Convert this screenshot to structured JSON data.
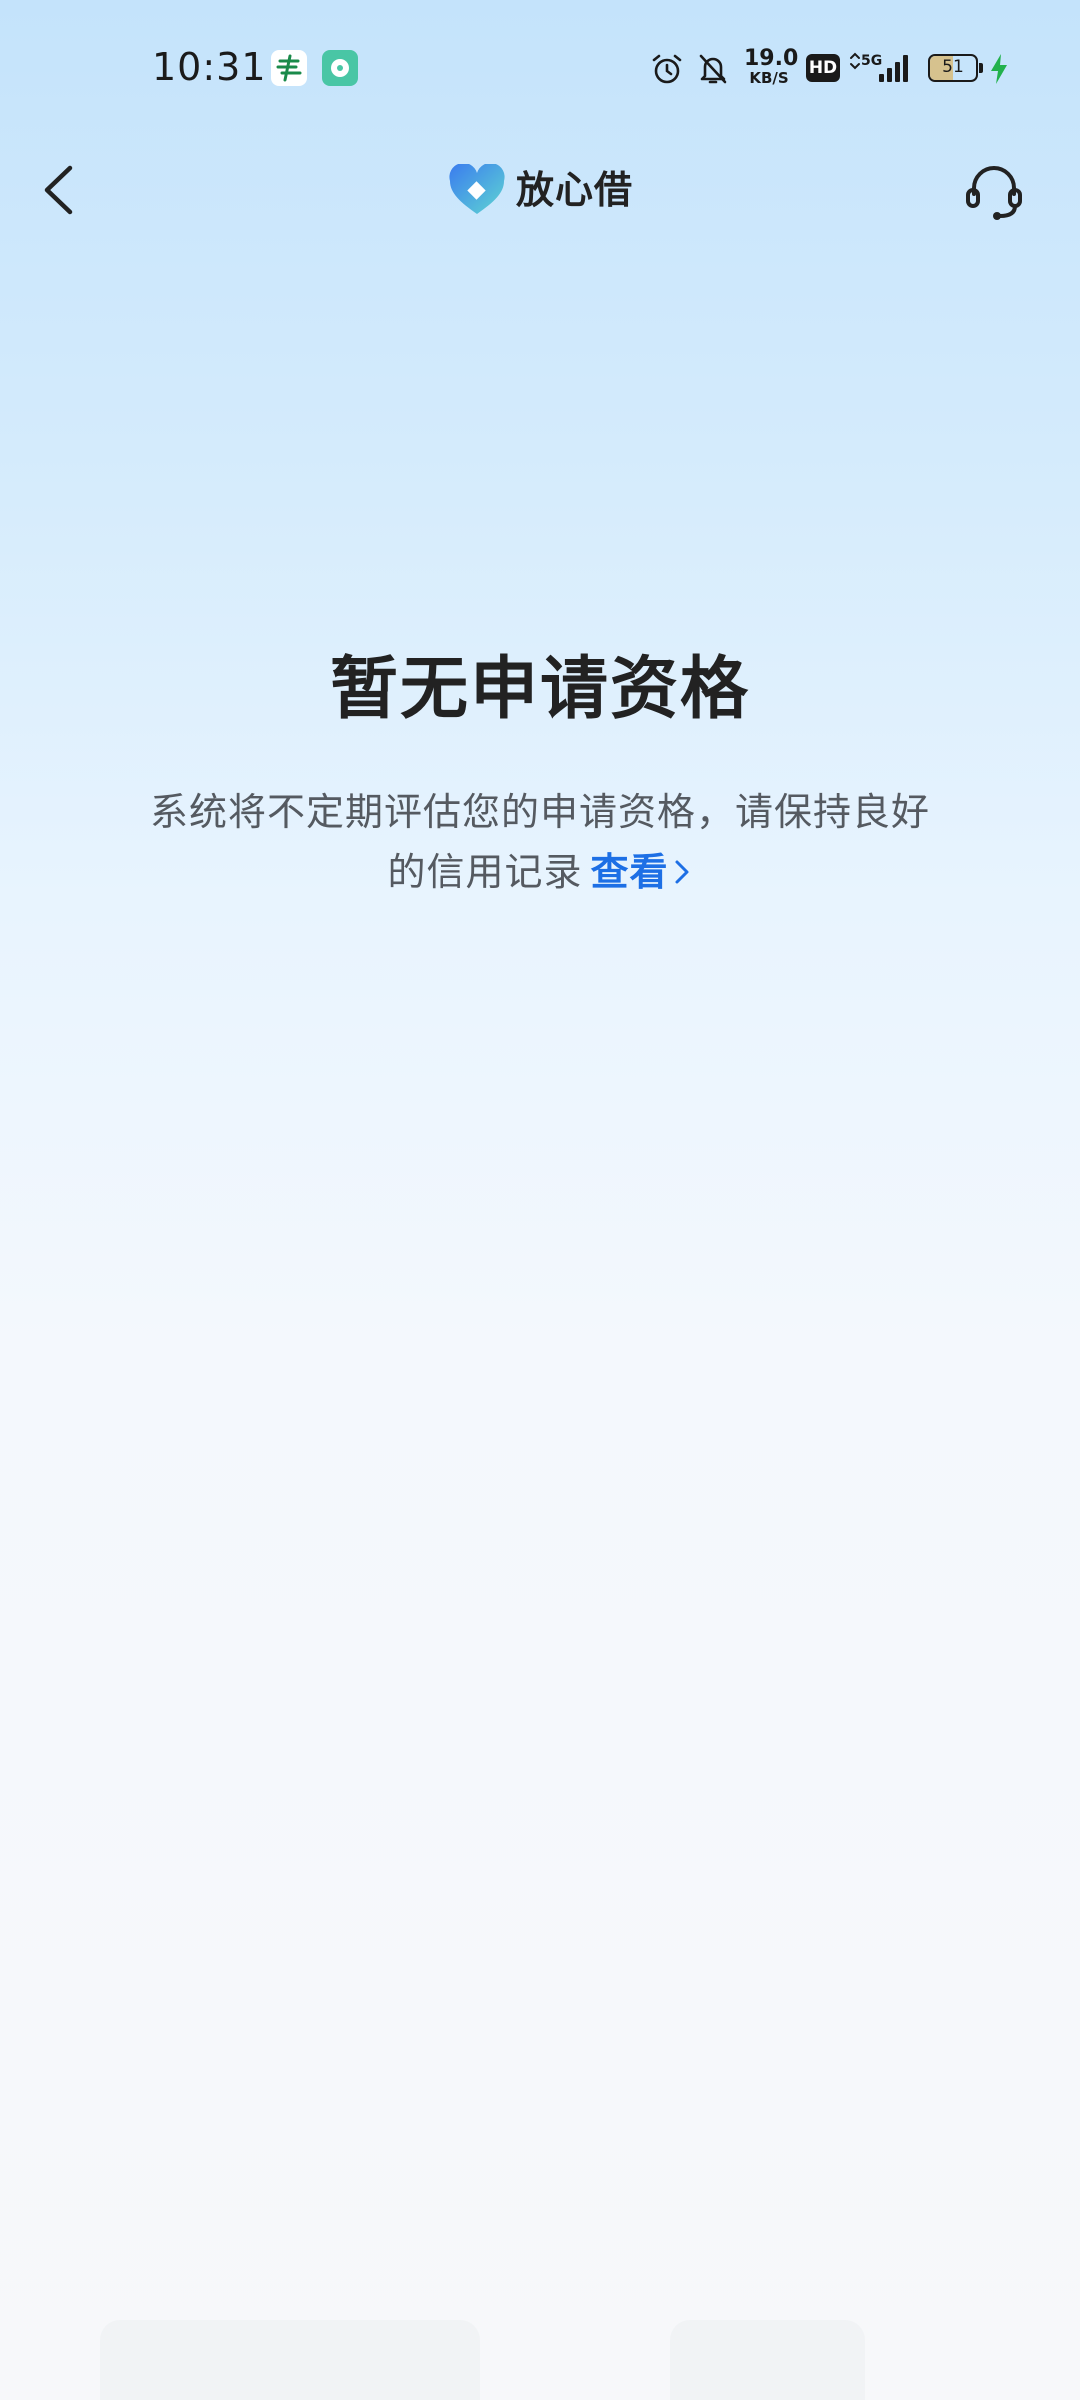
{
  "status_bar": {
    "time": "10:31",
    "app_icons": [
      "post-office-icon",
      "music-app-icon"
    ],
    "icons": [
      "alarm-icon",
      "bell-muted-icon",
      "hd-icon",
      "signal-5g-icon",
      "battery-icon",
      "charging-icon"
    ],
    "network_speed_value": "19.0",
    "network_speed_unit": "KB/S",
    "hd_label": "HD",
    "signal_label": "5G",
    "battery_level": "51",
    "battery_fraction": 0.51,
    "charging_color": "#22b14c"
  },
  "nav": {
    "back_icon": "chevron-left-icon",
    "brand_name": "放心借",
    "brand_icon": "heart-logo-icon",
    "service_icon": "headset-icon",
    "brand_colors": [
      "#3a7bef",
      "#5fd6d2"
    ]
  },
  "main": {
    "title": "暂无申请资格",
    "description": "系统将不定期评估您的申请资格，请保持良好的信用记录",
    "link_label": "查看",
    "link_icon": "chevron-right-icon",
    "link_color": "#1d6fe5"
  }
}
